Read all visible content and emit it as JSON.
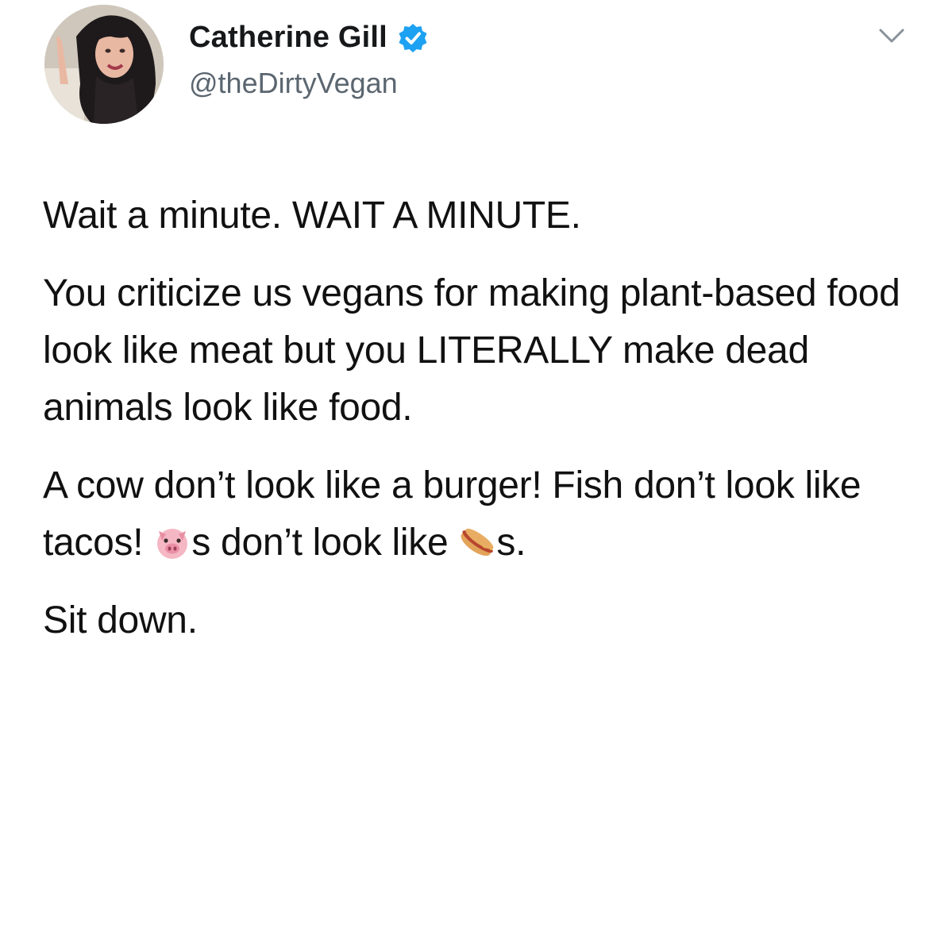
{
  "author": {
    "display_name": "Catherine Gill",
    "handle": "@theDirtyVegan",
    "verified": true,
    "avatar": "profile-photo"
  },
  "tweet": {
    "line1": "Wait a minute. WAIT A MINUTE.",
    "para2": "You criticize us vegans for making plant-based food look like meat but you LITERALLY make dead animals look like food.",
    "para3_part1": "A cow don’t look like a burger! Fish don’t look like tacos! ",
    "para3_part2": "s don’t look like ",
    "para3_part3": "s.",
    "para4": "Sit down.",
    "emoji_1": "pig-face-emoji",
    "emoji_2": "hot-dog-emoji"
  },
  "colors": {
    "verified_badge": "#1da1f2",
    "handle": "#5b6670",
    "text": "#111111"
  },
  "icons": {
    "menu_caret": "chevron-down-icon",
    "verified": "verified-badge-icon"
  }
}
